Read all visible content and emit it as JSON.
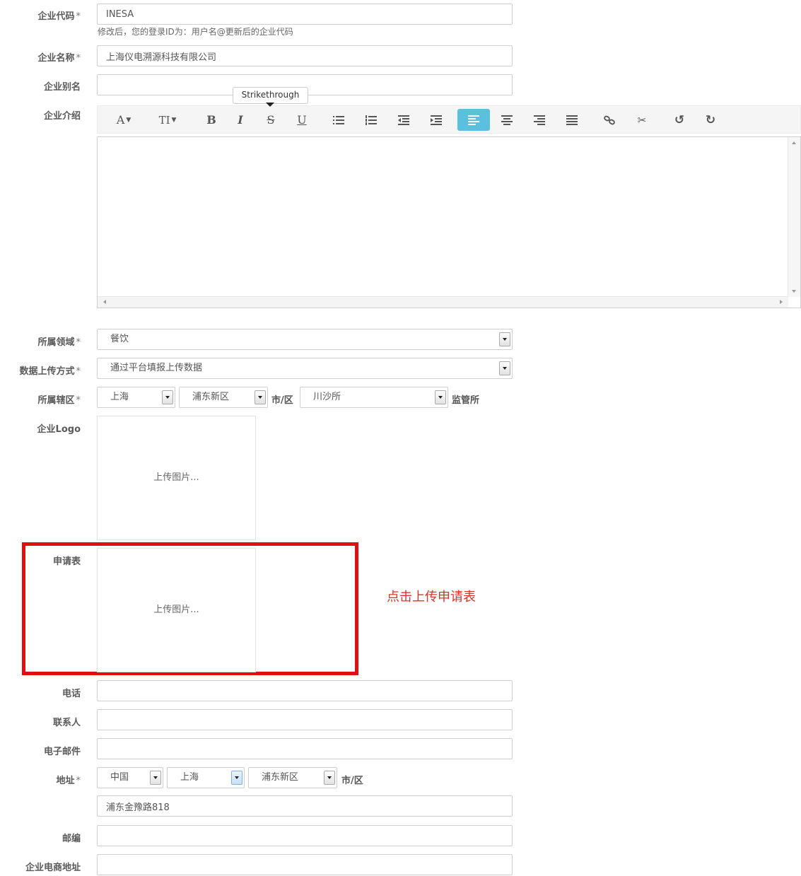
{
  "form": {
    "code": {
      "label": "企业代码",
      "req": "*",
      "value": "INESA",
      "hint": "修改后，您的登录ID为：用户名@更新后的企业代码"
    },
    "name": {
      "label": "企业名称",
      "req": "*",
      "value": "上海仪电溯源科技有限公司"
    },
    "alias": {
      "label": "企业别名",
      "value": ""
    },
    "intro": {
      "label": "企业介绍",
      "tooltip": "Strikethrough"
    },
    "domain": {
      "label": "所属领域",
      "req": "*",
      "value": "餐饮"
    },
    "upload_method": {
      "label": "数据上传方式",
      "req": "*",
      "value": "通过平台填报上传数据"
    },
    "region": {
      "label": "所属辖区",
      "req": "*",
      "province": "上海",
      "district": "浦东新区",
      "district_suffix": "市/区",
      "office": "川沙所",
      "office_suffix": "监管所"
    },
    "logo": {
      "label": "企业Logo",
      "upload_text": "上传图片..."
    },
    "application": {
      "label": "申请表",
      "upload_text": "上传图片..."
    },
    "phone": {
      "label": "电话",
      "value": ""
    },
    "contact": {
      "label": "联系人",
      "value": ""
    },
    "email": {
      "label": "电子邮件",
      "value": ""
    },
    "address": {
      "label": "地址",
      "req": "*",
      "country": "中国",
      "province": "上海",
      "district": "浦东新区",
      "district_suffix": "市/区",
      "street": "浦东金豫路818"
    },
    "zip": {
      "label": "邮编",
      "value": ""
    },
    "ecommerce": {
      "label": "企业电商地址",
      "value": ""
    }
  },
  "toolbar": {
    "font": "A",
    "size": "TI",
    "bold": "B",
    "italic": "I",
    "strike": "S",
    "underline": "U"
  },
  "annotation": {
    "text": "点击上传申请表",
    "color": "#d9342b"
  },
  "colors": {
    "accent": "#5bc0de",
    "highlight_border": "#e01010"
  }
}
